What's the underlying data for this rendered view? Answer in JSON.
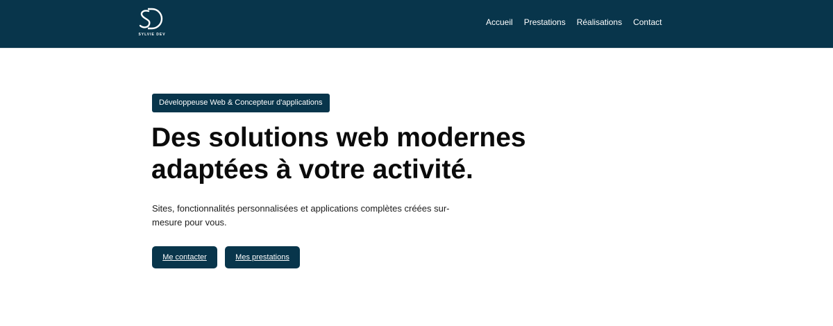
{
  "brand": {
    "logo_text": "SYLVIE DEV"
  },
  "nav": {
    "items": [
      "Accueil",
      "Prestations",
      "Réalisations",
      "Contact"
    ]
  },
  "hero": {
    "badge": "Développeuse Web & Concepteur d'applications",
    "title": "Des solutions web modernes adaptées à votre activité.",
    "subtitle": "Sites, fonctionnalités personnalisées et applications complètes créées sur-mesure pour vous.",
    "primary_button": "Me contacter",
    "secondary_button": "Mes prestations"
  },
  "colors": {
    "primary": "#08354b",
    "background": "#ffffff",
    "text": "#0b0b0b"
  }
}
